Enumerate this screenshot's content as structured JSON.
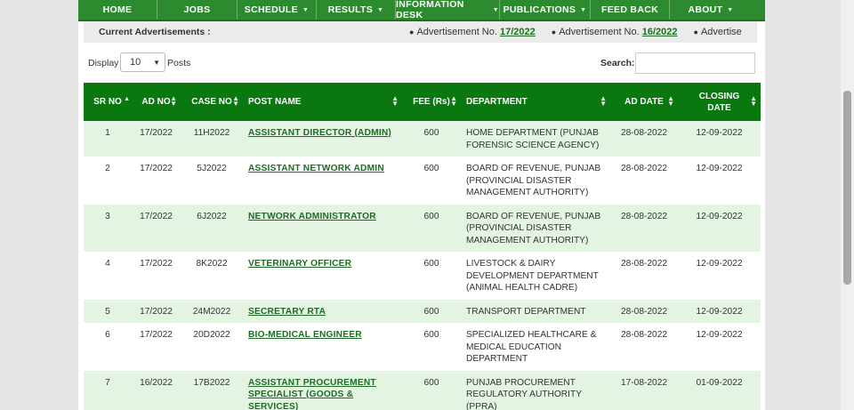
{
  "nav": {
    "items": [
      {
        "label": "HOME",
        "dropdown": false
      },
      {
        "label": "JOBS",
        "dropdown": false
      },
      {
        "label": "SCHEDULE",
        "dropdown": true
      },
      {
        "label": "RESULTS",
        "dropdown": true
      },
      {
        "label": "INFORMATION DESK",
        "dropdown": true
      },
      {
        "label": "PUBLICATIONS",
        "dropdown": true
      },
      {
        "label": "FEED BACK",
        "dropdown": false
      },
      {
        "label": "ABOUT",
        "dropdown": true
      }
    ]
  },
  "ticker": {
    "label": "Current Advertisements :",
    "items": [
      {
        "prefix": "Advertisement No.",
        "number": "17/2022"
      },
      {
        "prefix": "Advertisement No.",
        "number": "16/2022"
      },
      {
        "prefix": "Advertise",
        "number": ""
      }
    ]
  },
  "controls": {
    "display_label": "Display",
    "page_size": "10",
    "posts_label": "Posts",
    "search_label": "Search:",
    "search_value": ""
  },
  "table": {
    "headers": [
      "SR NO",
      "AD NO",
      "CASE NO",
      "POST NAME",
      "FEE (Rs)",
      "DEPARTMENT",
      "AD DATE",
      "CLOSING DATE"
    ],
    "rows": [
      {
        "sr": "1",
        "ad": "17/2022",
        "case": "11H2022",
        "post": "ASSISTANT DIRECTOR (ADMIN)",
        "fee": "600",
        "dept": "HOME DEPARTMENT (PUNJAB FORENSIC SCIENCE AGENCY)",
        "ad_date": "28-08-2022",
        "closing": "12-09-2022"
      },
      {
        "sr": "2",
        "ad": "17/2022",
        "case": "5J2022",
        "post": "ASSISTANT NETWORK ADMIN",
        "fee": "600",
        "dept": "BOARD OF REVENUE, PUNJAB (PROVINCIAL DISASTER MANAGEMENT AUTHORITY)",
        "ad_date": "28-08-2022",
        "closing": "12-09-2022"
      },
      {
        "sr": "3",
        "ad": "17/2022",
        "case": "6J2022",
        "post": "NETWORK ADMINISTRATOR",
        "fee": "600",
        "dept": "BOARD OF REVENUE, PUNJAB (PROVINCIAL DISASTER MANAGEMENT AUTHORITY)",
        "ad_date": "28-08-2022",
        "closing": "12-09-2022"
      },
      {
        "sr": "4",
        "ad": "17/2022",
        "case": "8K2022",
        "post": "VETERINARY OFFICER",
        "fee": "600",
        "dept": "LIVESTOCK & DAIRY DEVELOPMENT DEPARTMENT (ANIMAL HEALTH CADRE)",
        "ad_date": "28-08-2022",
        "closing": "12-09-2022"
      },
      {
        "sr": "5",
        "ad": "17/2022",
        "case": "24M2022",
        "post": "SECRETARY RTA",
        "fee": "600",
        "dept": "TRANSPORT DEPARTMENT",
        "ad_date": "28-08-2022",
        "closing": "12-09-2022"
      },
      {
        "sr": "6",
        "ad": "17/2022",
        "case": "20D2022",
        "post": "BIO-MEDICAL ENGINEER",
        "fee": "600",
        "dept": "SPECIALIZED HEALTHCARE & MEDICAL EDUCATION DEPARTMENT",
        "ad_date": "28-08-2022",
        "closing": "12-09-2022"
      },
      {
        "sr": "7",
        "ad": "16/2022",
        "case": "17B2022",
        "post": "ASSISTANT PROCUREMENT SPECIALIST (GOODS & SERVICES)",
        "fee": "600",
        "dept": "PUNJAB PROCUREMENT REGULATORY AUTHORITY (PPRA)",
        "ad_date": "17-08-2022",
        "closing": "01-09-2022"
      }
    ]
  },
  "colors": {
    "nav_bg": "#2c8a2f",
    "header_bg": "#08780f",
    "row_alt": "#e3f4e3",
    "link": "#1e6b23"
  }
}
